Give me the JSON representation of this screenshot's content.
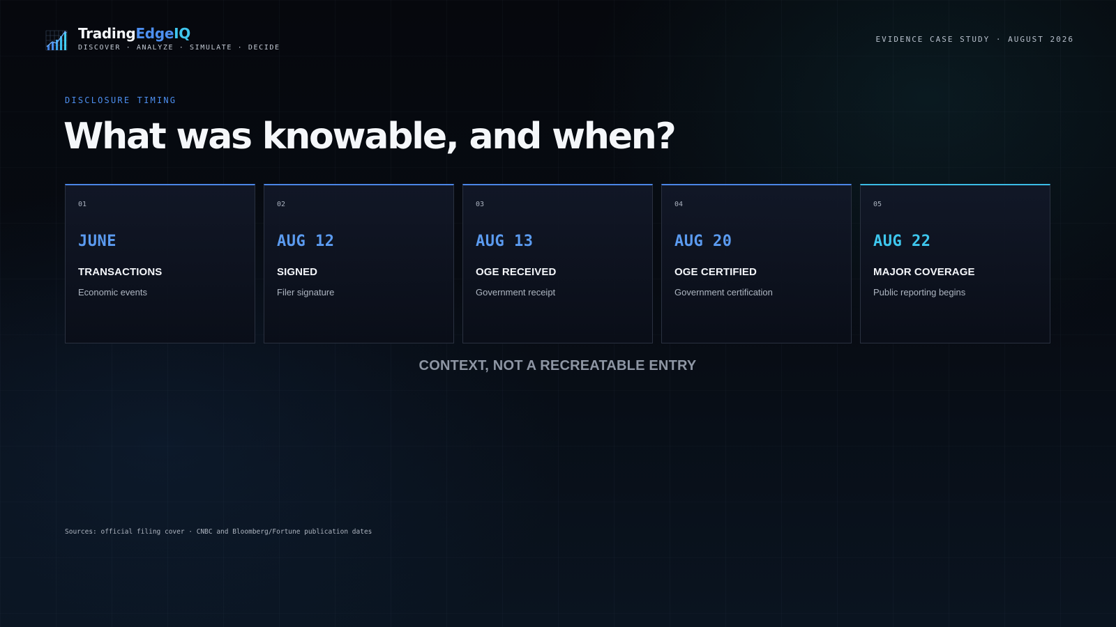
{
  "brand": {
    "name_part1": "Trading",
    "name_part2": "Edge",
    "name_part3": "IQ",
    "tagline": "DISCOVER · ANALYZE · SIMULATE · DECIDE",
    "logo_icon": "bar-chart-growth-icon"
  },
  "header": {
    "case_study_label": "EVIDENCE CASE STUDY · AUGUST 2026"
  },
  "section": {
    "eyebrow": "DISCLOSURE TIMING",
    "headline": "What was knowable, and when?"
  },
  "timeline": [
    {
      "num": "01",
      "date": "JUNE",
      "title": "TRANSACTIONS",
      "desc": "Economic events"
    },
    {
      "num": "02",
      "date": "AUG 12",
      "title": "SIGNED",
      "desc": "Filer signature"
    },
    {
      "num": "03",
      "date": "AUG 13",
      "title": "OGE RECEIVED",
      "desc": "Government receipt"
    },
    {
      "num": "04",
      "date": "AUG 20",
      "title": "OGE CERTIFIED",
      "desc": "Government certification"
    },
    {
      "num": "05",
      "date": "AUG 22",
      "title": "MAJOR COVERAGE",
      "desc": "Public reporting begins"
    }
  ],
  "context_note": "CONTEXT, NOT A RECREATABLE ENTRY",
  "sources": "Sources: official filing cover · CNBC and Bloomberg/Fortune publication dates",
  "colors": {
    "accent_blue": "#4d8ff0",
    "accent_cyan": "#3fc6ee",
    "background": "#06080d"
  }
}
